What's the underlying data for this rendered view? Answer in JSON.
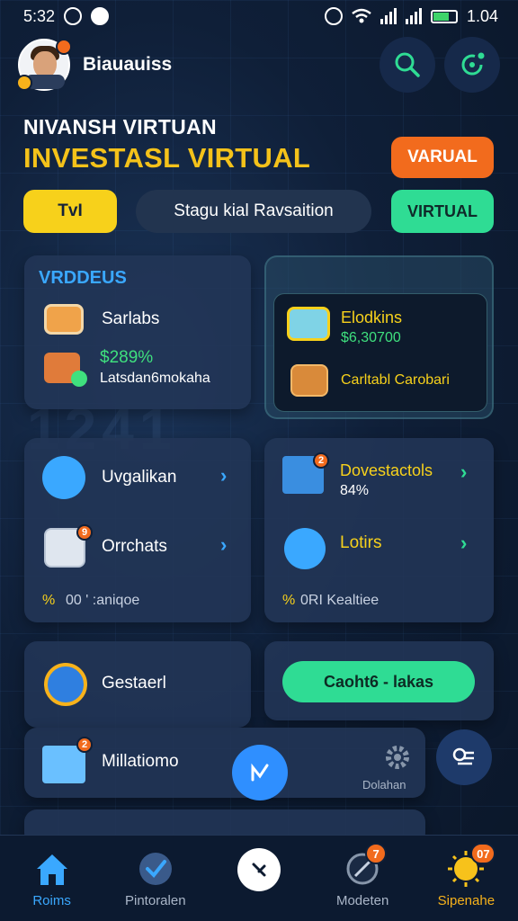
{
  "status_bar": {
    "time": "5:32",
    "battery_text": "1.04"
  },
  "header": {
    "brand": "Biauauiss",
    "avatar_badge": ""
  },
  "hero": {
    "subtitle": "NIVANSH VIRTUAN",
    "title": "INVESTASL VIRTUAL",
    "orange_pill": "VARUAL",
    "yellow_pill": "TvI",
    "center_pill": "Stagu kial Ravsaition",
    "green_pill": "VIRTUAL"
  },
  "card_left_top": {
    "section_title": "VRDDEUS",
    "item1_label": "Sarlabs",
    "item2_value": "$289%",
    "item2_label": "Latsdan6mokaha"
  },
  "card_right_top": {
    "item1_title": "Elodkins",
    "item1_value": "$6,30700",
    "item2_label": "Carltabl Carobari"
  },
  "card_left_mid": {
    "item1_label": "Uvgalikan",
    "item2_label": "Orrchats",
    "badge": "9",
    "footer_prefix": "%",
    "footer_text": "00 ' :aniqoe"
  },
  "card_right_mid": {
    "item1_title": "Dovestactols",
    "item1_value": "84%",
    "item2_label": "Lotirs",
    "badge": "2",
    "footer_prefix": "%",
    "footer_text": "0RI Kealtiee"
  },
  "card_left_bottom": {
    "label": "Gestaerl"
  },
  "card_right_bottom": {
    "cta": "Caoht6 - lakas"
  },
  "card_list": {
    "label": "Millatiomo",
    "badge": "2",
    "gear_label": "Dolahan"
  },
  "colors": {
    "accent_green": "#2fdc94",
    "accent_orange": "#f26b1d",
    "accent_yellow": "#f7d11b",
    "accent_blue": "#3aa8ff"
  },
  "bottom_nav": {
    "items": [
      {
        "label": "Roims",
        "icon": "home-icon",
        "active": true
      },
      {
        "label": "Pintoralen",
        "icon": "checklist-icon"
      },
      {
        "label": "",
        "icon": "center-action-icon"
      },
      {
        "label": "Modeten",
        "icon": "compass-icon",
        "badge": "7"
      },
      {
        "label": "Sipenahe",
        "icon": "sun-icon",
        "badge": "07"
      }
    ]
  }
}
